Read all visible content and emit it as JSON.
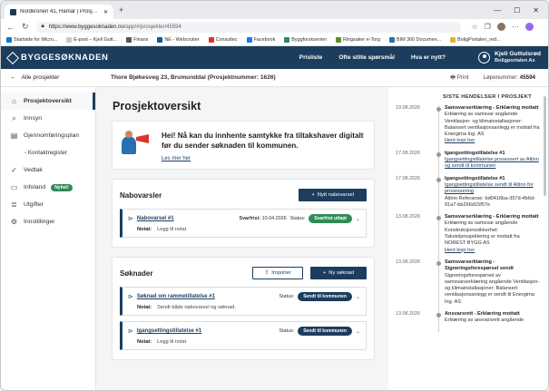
{
  "browser": {
    "tab_title": "Nordkronen 41, Hamar | Prosjekto...",
    "url_domain": "https://www.byggesoknaden.no",
    "url_path": "/app/#/prosjekter/45594",
    "bookmarks": [
      {
        "label": "Startside for Micro...",
        "color": "#0078d4"
      },
      {
        "label": "E-post – Kjell Gutt...",
        "color": "#c8c8c8"
      },
      {
        "label": "Finans",
        "color": "#555555"
      },
      {
        "label": "NE - Webcruiter",
        "color": "#0a5a9c"
      },
      {
        "label": "Consultec",
        "color": "#d9362b"
      },
      {
        "label": "Facebook",
        "color": "#1877f2"
      },
      {
        "label": "Byggforskserien",
        "color": "#2e8b57"
      },
      {
        "label": "Ringsaker e-Torg",
        "color": "#5b8c2a"
      },
      {
        "label": "BIM 360 Documen...",
        "color": "#2a6fb1"
      },
      {
        "label": "BoligPortalen_red...",
        "color": "#e3b341"
      }
    ]
  },
  "header": {
    "logo": "BYGGESØKNADEN",
    "nav": [
      "Prisliste",
      "Ofte stilte spørsmål",
      "Hva er nytt?"
    ],
    "user_name": "Kjell Guttulsrød",
    "user_org": "Boligportalen As"
  },
  "project_bar": {
    "back_label": "Alle prosjekter",
    "project": "Thore Bjøkesveg 23, Brumunddal  (Prosjektnummer: 1626)",
    "print_label": "Print",
    "lopenummer_label": "Løpenummer:",
    "lopenummer": "45594"
  },
  "sidebar": {
    "items": [
      {
        "label": "Prosjektoversikt",
        "icon": "house-icon"
      },
      {
        "label": "Innsyn",
        "icon": "search-icon"
      },
      {
        "label": "Gjennomføringsplan",
        "icon": "document-icon"
      },
      {
        "label": "- Kontaktregister",
        "icon": ""
      },
      {
        "label": "Vedtak",
        "icon": "stamp-icon"
      },
      {
        "label": "Infoland",
        "icon": "folder-icon",
        "badge": "Nyhet!"
      },
      {
        "label": "Utgifter",
        "icon": "receipt-icon"
      },
      {
        "label": "Innstillinger",
        "icon": "gear-icon"
      }
    ]
  },
  "main": {
    "title": "Prosjektoversikt",
    "welcome_text": "Hei! Nå kan du innhente samtykke fra tiltakshaver digitalt før du sender søknaden til kommunen.",
    "welcome_link": "Les mer her",
    "nabovarsler": {
      "title": "Nabovarsler",
      "new_button": "Nytt nabovarsel",
      "rows": [
        {
          "link": "Nabovarsel #1",
          "deadline_label": "Svarfrist:",
          "deadline": "10.04.2026",
          "status_label": "Status:",
          "status": "Svarfrist utløpt",
          "note_label": "Notat:",
          "note": "Legg til notat"
        }
      ]
    },
    "soknader": {
      "title": "Søknader",
      "import_button": "Importer",
      "new_button": "Ny søknad",
      "rows": [
        {
          "link": "Søknad om rammetillatelse #1",
          "status_label": "Status:",
          "status": "Sendt til kommunen",
          "note_label": "Notat:",
          "note": "Sendt både nabovarsel og søknad."
        },
        {
          "link": "Igangsettingstillatelse #1",
          "status_label": "Status:",
          "status": "Sendt til kommunen",
          "note_label": "Notat:",
          "note": "Legg til notat"
        }
      ]
    }
  },
  "events": {
    "title": "SISTE HENDELSER I PROSJEKT",
    "items": [
      {
        "date": "19.08.2026",
        "title": "Samsvarserklæring - Erklæring mottatt",
        "body": "Erklæring av samsvar angående Ventilasjon- og klimainstallasjoner: Balansert ventilasjonsanlegg er mottatt fra Energima Ing. AS",
        "link": "Hent kopi her"
      },
      {
        "date": "17.08.2026",
        "title": "Igangsettingstillatelse #1",
        "body": "",
        "link": "Igangsettingstillatelse prosessert av Altinn og sendt til kommunen"
      },
      {
        "date": "17.08.2026",
        "title": "Igangsettingstillatelse #1",
        "body": "Altinn Referanse: bd0416ba-357d-4b6d-91a7-bb266d15f57e",
        "link": "Igangsettingstillatelse sendt til Altinn for prosessering"
      },
      {
        "date": "13.08.2026",
        "title": "Samsvarserklæring - Erklæring mottatt",
        "body": "Erklæring av samsvar angående Konstruksjonssikkerhet: Takstolprosjektering er mottatt fra NOREST BYGG AS",
        "link": "Hent kopi her"
      },
      {
        "date": "13.08.2026",
        "title": "Samsvarserklæring - Signeringsforespørsel sendt",
        "body": "Signeringsforespørsel av samsvarserklæring angående Ventilasjon- og klimainstallasjoner: Balansert ventilasjonsanlegg er sendt til Energima Ing. AS",
        "link": ""
      },
      {
        "date": "13.08.2026",
        "title": "Ansvarsrett - Erklæring mottatt",
        "body": "Erklæring av ansvarsrett angående",
        "link": ""
      }
    ]
  }
}
